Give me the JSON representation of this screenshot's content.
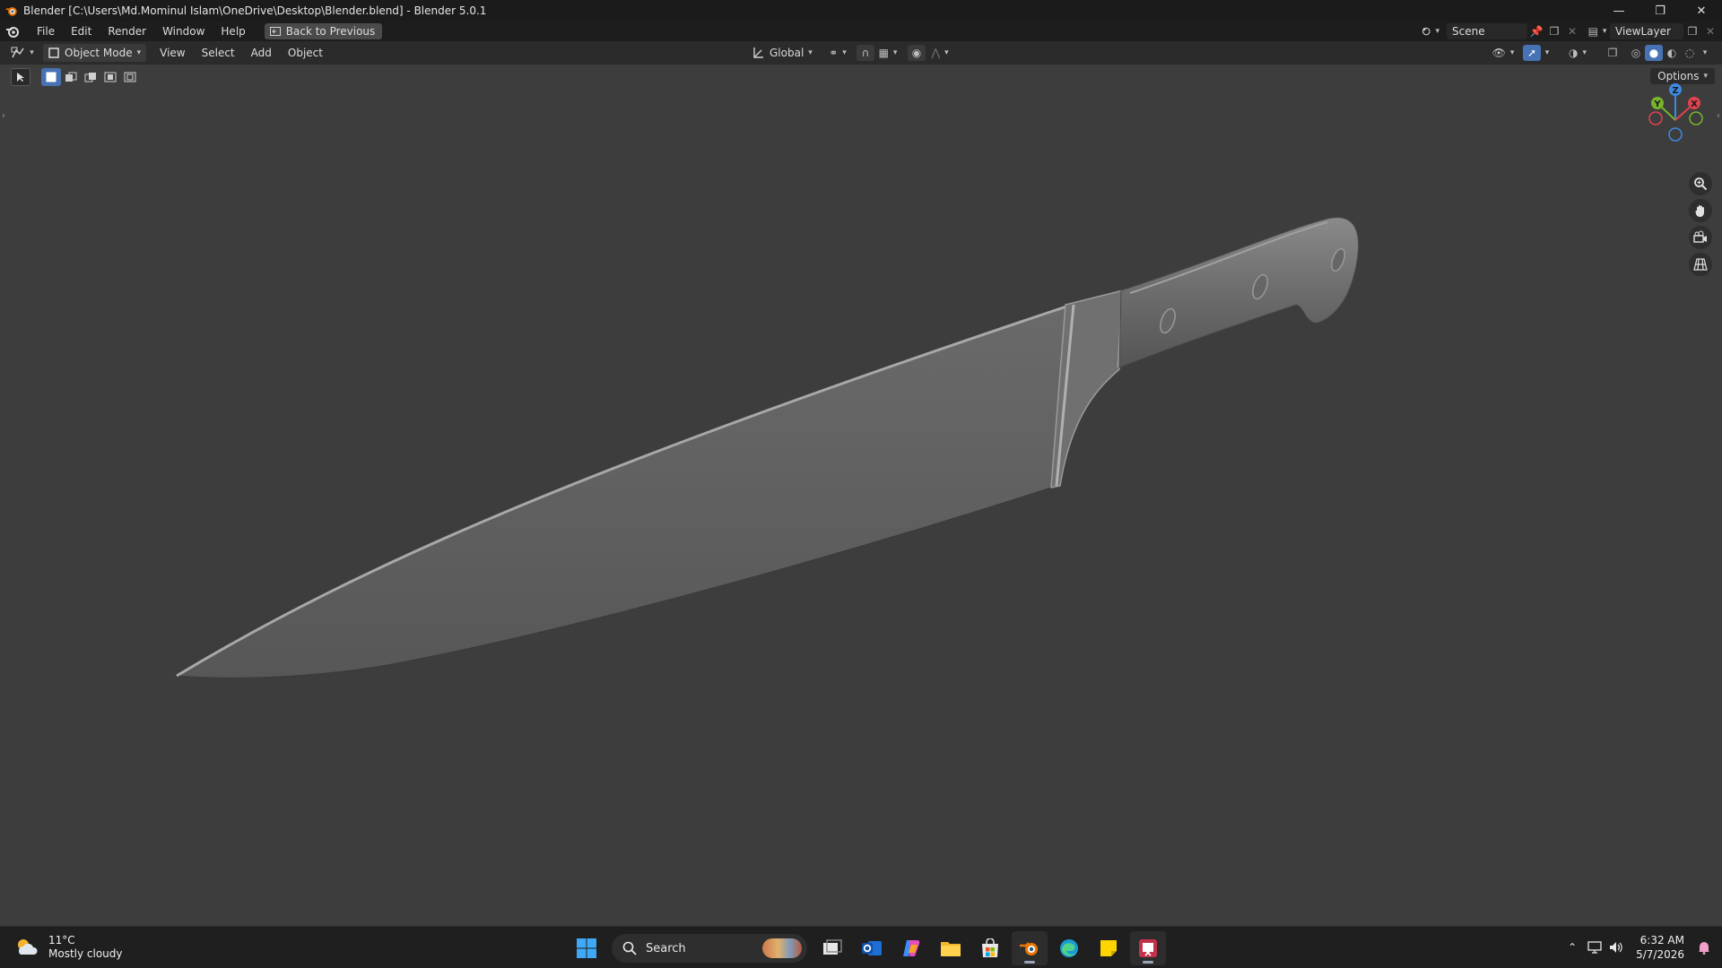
{
  "window": {
    "title": "Blender [C:\\Users\\Md.Mominul Islam\\OneDrive\\Desktop\\Blender.blend] - Blender 5.0.1",
    "controls": [
      "minimize-icon",
      "restore-icon",
      "close-icon"
    ]
  },
  "menubar": {
    "items": [
      "File",
      "Edit",
      "Render",
      "Window",
      "Help"
    ],
    "back_button": "Back to Previous",
    "scene_label": "Scene",
    "view_layer_label": "ViewLayer"
  },
  "viewport_header": {
    "mode": "Object Mode",
    "menus": [
      "View",
      "Select",
      "Add",
      "Object"
    ],
    "transform_orientation": "Global"
  },
  "viewport": {
    "options_label": "Options",
    "gizmo_axes": [
      "Z",
      "Y",
      "X"
    ],
    "object": "chef-knife",
    "background_color": "#3d3d3d",
    "axis_colors": {
      "x": "#e0424f",
      "y": "#79b32c",
      "z": "#3d8ae0"
    }
  },
  "taskbar": {
    "weather_temp": "11°C",
    "weather_desc": "Mostly cloudy",
    "search_label": "Search",
    "time": "6:32 AM",
    "date": "5/7/2026",
    "apps": [
      "start-icon",
      "search",
      "task-view-icon",
      "outlook-icon",
      "copilot-icon",
      "file-explorer-icon",
      "store-icon",
      "blender-icon",
      "edge-icon",
      "sticky-notes-icon",
      "snipping-tool-icon"
    ]
  }
}
